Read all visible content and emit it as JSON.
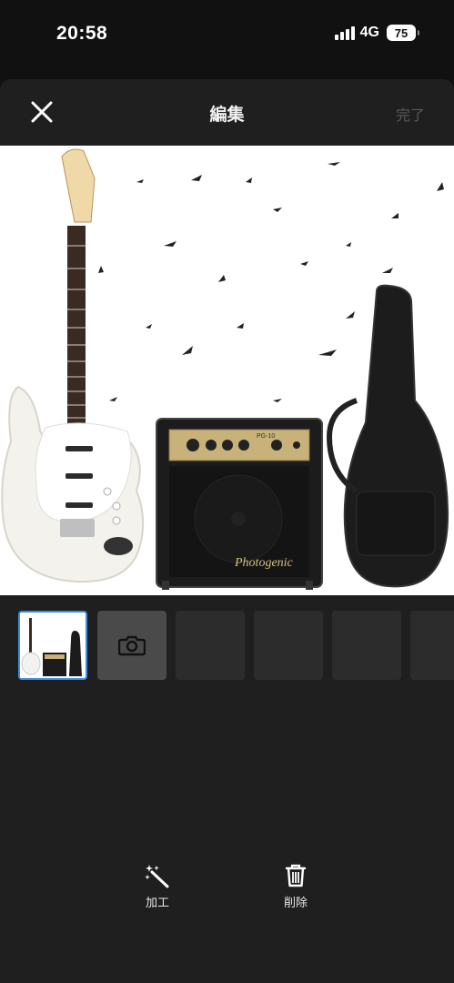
{
  "status": {
    "time": "20:58",
    "network": "4G",
    "battery": "75"
  },
  "header": {
    "title": "編集",
    "done_label": "完了",
    "close_icon": "close-icon"
  },
  "main_image": {
    "amp_brand": "Photogenic",
    "amp_model": "PG-10"
  },
  "thumbnails": {
    "camera_icon": "camera-icon",
    "empty_slots": 4
  },
  "actions": {
    "edit_label": "加工",
    "delete_label": "削除"
  },
  "colors": {
    "accent": "#3d8ee8",
    "background": "#1f1f1f",
    "done_disabled": "#5a5a5a"
  }
}
